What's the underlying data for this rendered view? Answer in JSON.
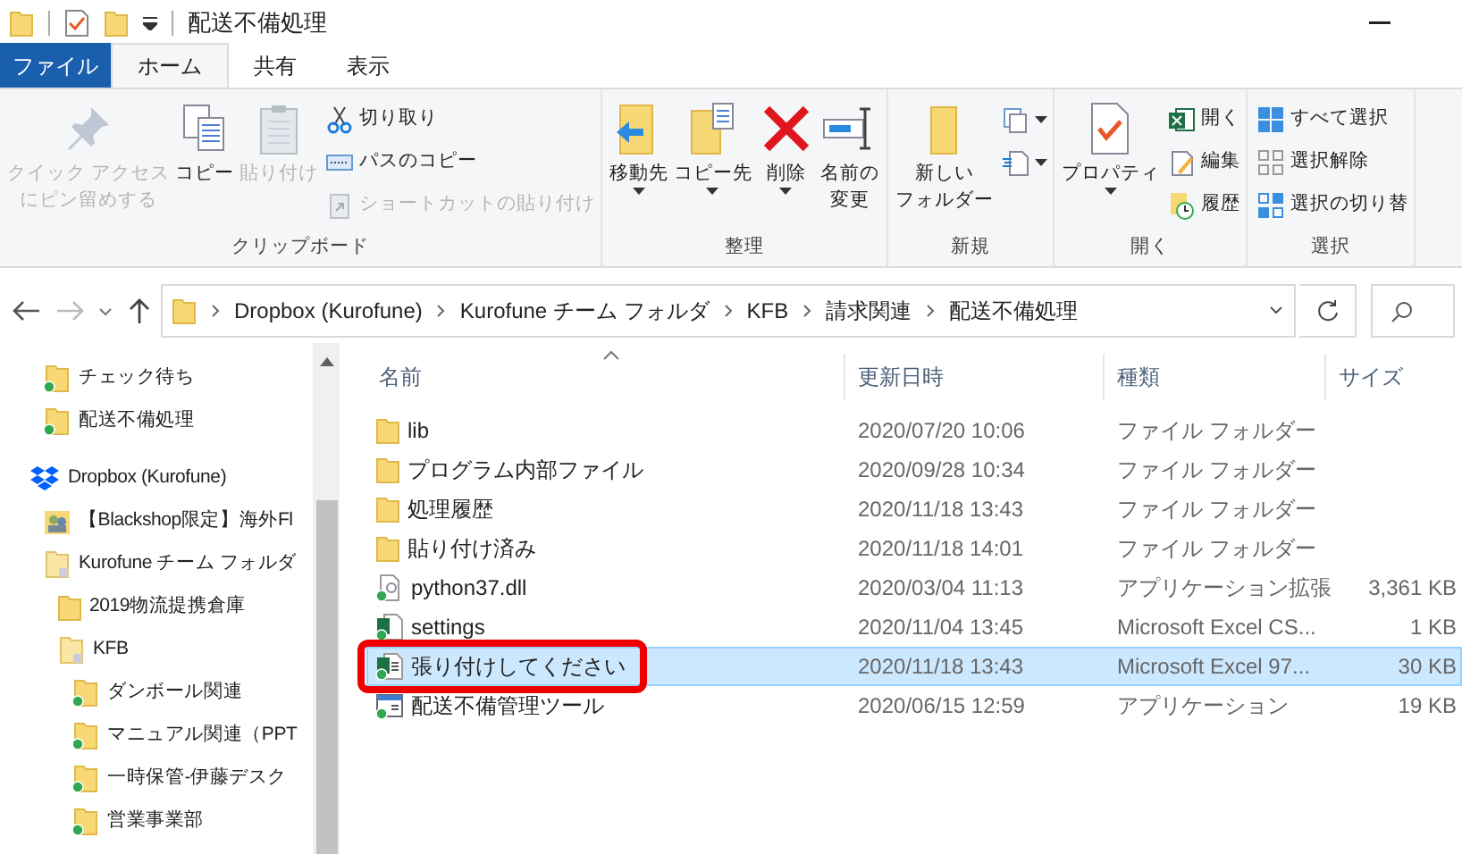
{
  "window": {
    "title": "配送不備処理"
  },
  "tabs": [
    {
      "label": "ファイル",
      "selected": false,
      "kind": "file"
    },
    {
      "label": "ホーム",
      "selected": true,
      "kind": "tab"
    },
    {
      "label": "共有",
      "selected": false,
      "kind": "tab"
    },
    {
      "label": "表示",
      "selected": false,
      "kind": "tab"
    }
  ],
  "ribbon": {
    "groups": [
      {
        "label": "クリップボード",
        "large": [
          {
            "lines": [
              "クイック アクセス",
              "にピン留めする"
            ],
            "kind": "pin",
            "disabled": true
          },
          {
            "lines": [
              "コピー"
            ],
            "kind": "copy",
            "disabled": false
          },
          {
            "lines": [
              "貼り付け"
            ],
            "kind": "paste",
            "disabled": true
          }
        ],
        "small": [
          {
            "label": "切り取り",
            "kind": "cut",
            "disabled": false
          },
          {
            "label": "パスのコピー",
            "kind": "path",
            "disabled": false
          },
          {
            "label": "ショートカットの貼り付け",
            "kind": "shortcut",
            "disabled": true
          }
        ]
      },
      {
        "label": "整理",
        "large": [
          {
            "lines": [
              "移動先"
            ],
            "kind": "move",
            "disabled": false
          },
          {
            "lines": [
              "コピー先"
            ],
            "kind": "copyto",
            "disabled": false
          },
          {
            "lines": [
              "削除"
            ],
            "kind": "delete",
            "disabled": false
          },
          {
            "lines": [
              "名前の",
              "変更"
            ],
            "kind": "rename",
            "disabled": false
          }
        ]
      },
      {
        "label": "新規",
        "large": [
          {
            "lines": [
              "新しい",
              "フォルダー"
            ],
            "kind": "newfolder",
            "disabled": false
          }
        ],
        "small": [
          {
            "kind": "newitem",
            "disabled": false
          },
          {
            "kind": "easyaccess",
            "disabled": false
          }
        ]
      },
      {
        "label": "開く",
        "large": [
          {
            "lines": [
              "プロパティ"
            ],
            "kind": "properties",
            "disabled": false
          }
        ],
        "small": [
          {
            "label": "開く",
            "kind": "open",
            "disabled": false
          },
          {
            "label": "編集",
            "kind": "edit",
            "disabled": false
          },
          {
            "label": "履歴",
            "kind": "history",
            "disabled": false
          }
        ]
      },
      {
        "label": "選択",
        "small": [
          {
            "label": "すべて選択",
            "kind": "selectall",
            "disabled": false
          },
          {
            "label": "選択解除",
            "kind": "selectnone",
            "disabled": false
          },
          {
            "label": "選択の切り替",
            "kind": "invert",
            "disabled": false
          }
        ]
      }
    ]
  },
  "address": {
    "crumbs": [
      "Dropbox (Kurofune)",
      "Kurofune チーム フォルダ",
      "KFB",
      "請求関連",
      "配送不備処理"
    ]
  },
  "sidebar": {
    "quick_access": [
      {
        "label": "チェック待ち",
        "kind": "synced"
      },
      {
        "label": "配送不備処理",
        "kind": "synced"
      }
    ],
    "tree": [
      {
        "label": "Dropbox (Kurofune)",
        "kind": "dropbox",
        "children": [
          {
            "label": "【Blackshop限定】海外Fl",
            "kind": "shared"
          },
          {
            "label": "Kurofune チーム フォルダ",
            "kind": "team",
            "children": [
              {
                "label": "2019物流提携倉庫",
                "kind": "folder"
              },
              {
                "label": "KFB",
                "kind": "team",
                "children": [
                  {
                    "label": "ダンボール関連",
                    "kind": "synced"
                  },
                  {
                    "label": "マニュアル関連（PPT",
                    "kind": "synced"
                  },
                  {
                    "label": "一時保管-伊藤デスク",
                    "kind": "synced"
                  },
                  {
                    "label": "営業事業部",
                    "kind": "synced"
                  }
                ]
              }
            ]
          }
        ]
      }
    ]
  },
  "columns": [
    "名前",
    "更新日時",
    "種類",
    "サイズ"
  ],
  "files": [
    {
      "name": "lib",
      "modified": "2020/07/20 10:06",
      "type": "ファイル フォルダー",
      "kind": "folder",
      "selected": false,
      "marked": false
    },
    {
      "name": "プログラム内部ファイル",
      "modified": "2020/09/28 10:34",
      "type": "ファイル フォルダー",
      "kind": "folder",
      "selected": false,
      "marked": false
    },
    {
      "name": "処理履歴",
      "modified": "2020/11/18 13:43",
      "type": "ファイル フォルダー",
      "kind": "folder",
      "selected": false,
      "marked": false
    },
    {
      "name": "貼り付け済み",
      "modified": "2020/11/18 14:01",
      "type": "ファイル フォルダー",
      "kind": "folder",
      "selected": false,
      "marked": false
    },
    {
      "name": "python37.dll",
      "modified": "2020/03/04 11:13",
      "type": "アプリケーション拡張",
      "size": "3,361 KB",
      "kind": "dll",
      "selected": false,
      "marked": false
    },
    {
      "name": "settings",
      "modified": "2020/11/04 13:45",
      "type": "Microsoft Excel CS...",
      "size": "1 KB",
      "kind": "csv",
      "selected": false,
      "marked": false
    },
    {
      "name": "張り付けしてください",
      "modified": "2020/11/18 13:43",
      "type": "Microsoft Excel 97...",
      "size": "30 KB",
      "kind": "xls",
      "selected": true,
      "marked": true
    },
    {
      "name": "配送不備管理ツール",
      "modified": "2020/06/15 12:59",
      "type": "アプリケーション",
      "size": "19 KB",
      "kind": "exe",
      "selected": false,
      "marked": false
    }
  ]
}
